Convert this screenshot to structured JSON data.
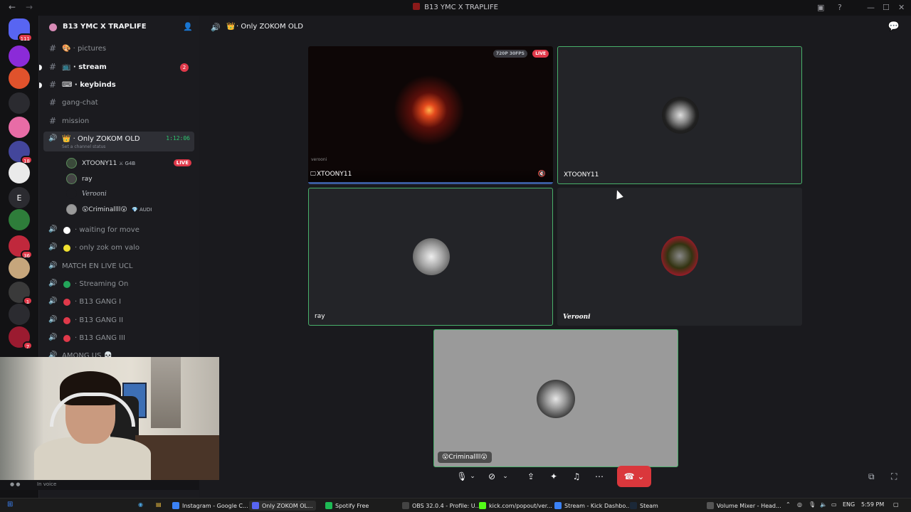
{
  "window": {
    "title": "B13 YMC X TRAPLIFE"
  },
  "rail": {
    "servers": [
      {
        "label": "",
        "color": "#5865f2",
        "badge": "111"
      },
      {
        "label": "",
        "color": "#8b2bd8",
        "badge": ""
      },
      {
        "label": "",
        "color": "#e0522c",
        "badge": ""
      },
      {
        "label": "",
        "color": "#2b2b30",
        "badge": ""
      },
      {
        "label": "",
        "color": "#e86ca6",
        "badge": ""
      },
      {
        "label": "",
        "color": "#43469b",
        "badge": "18"
      },
      {
        "label": "",
        "color": "#eaeaea",
        "badge": ""
      },
      {
        "label": "E",
        "color": "#2b2b30",
        "badge": ""
      },
      {
        "label": "",
        "color": "#2e7d3a",
        "badge": ""
      },
      {
        "label": "",
        "color": "#c0283c",
        "badge": "36"
      },
      {
        "label": "",
        "color": "#c6a67c",
        "badge": ""
      },
      {
        "label": "",
        "color": "#3a3a3a",
        "badge": "1"
      },
      {
        "label": "",
        "color": "#2b2b30",
        "badge": ""
      },
      {
        "label": "",
        "color": "#9b1b30",
        "badge": "7"
      }
    ]
  },
  "sidebar": {
    "server_name": "B13 YMC X TRAPLIFE",
    "channels": [
      {
        "type": "text",
        "emoji": "🎨",
        "label": "pictures",
        "unread": false
      },
      {
        "type": "text",
        "emoji": "📺",
        "label": "stream",
        "unread": true,
        "count": "2"
      },
      {
        "type": "text",
        "emoji": "⌨",
        "label": "keybinds",
        "unread": true
      },
      {
        "type": "text",
        "emoji": "",
        "label": "gang-chat",
        "unread": false
      },
      {
        "type": "text",
        "emoji": "",
        "label": "mission",
        "unread": false
      }
    ],
    "active_voice": {
      "emoji": "👑",
      "label": "Only ZOKOM OLD",
      "timer": "1:12:06",
      "status": "Set a channel status",
      "users": [
        {
          "name": "XTOONY11",
          "tag": "G4B",
          "live": "LIVE"
        },
        {
          "name": "ray",
          "tag": "",
          "live": ""
        },
        {
          "name": "Verooni",
          "tag": "",
          "live": ""
        },
        {
          "name": "😮Criminallll😮",
          "tag": "AUDI",
          "live": ""
        }
      ]
    },
    "voice_channels": [
      {
        "dot": "#ffffff",
        "label": "waiting for move"
      },
      {
        "dot": "#f0e130",
        "label": "only zok om valo"
      },
      {
        "dot": "",
        "label": "MATCH EN LIVE UCL"
      },
      {
        "dot": "#23a55a",
        "label": "Streaming On"
      },
      {
        "dot": "#e0394a",
        "label": "B13 GANG I"
      },
      {
        "dot": "#e0394a",
        "label": "B13 GANG II"
      },
      {
        "dot": "#e0394a",
        "label": "B13 GANG III"
      },
      {
        "dot": "",
        "label": "AMONG US 💀"
      }
    ],
    "user_status": "In voice"
  },
  "main": {
    "channel_emoji": "👑",
    "channel_title": "Only ZOKOM OLD",
    "tiles": {
      "stream": {
        "name": "XTOONY11",
        "quality": "720P 30FPS",
        "live": "LIVE",
        "small": "verooni"
      },
      "xtoony": {
        "name": "XTOONY11"
      },
      "ray": {
        "name": "ray"
      },
      "verooni": {
        "name": "Verooni"
      },
      "criminal": {
        "name": "😮Criminallll😮"
      }
    }
  },
  "taskbar": {
    "items": [
      {
        "label": "Instagram - Google C...",
        "color": "#3b82f6"
      },
      {
        "label": "Only ZOKOM OL...",
        "color": "#5865f2",
        "active": true
      },
      {
        "label": "Spotify Free",
        "color": "#1db954"
      },
      {
        "label": "OBS 32.0.4 - Profile: U...",
        "color": "#444"
      },
      {
        "label": "kick.com/popout/ver...",
        "color": "#53fc18"
      },
      {
        "label": "Stream - Kick Dashbo...",
        "color": "#3b82f6"
      },
      {
        "label": "Steam",
        "color": "#1b2838"
      },
      {
        "label": "Volume Mixer - Head...",
        "color": "#555"
      }
    ],
    "lang": "ENG",
    "time": "5:59 PM"
  }
}
